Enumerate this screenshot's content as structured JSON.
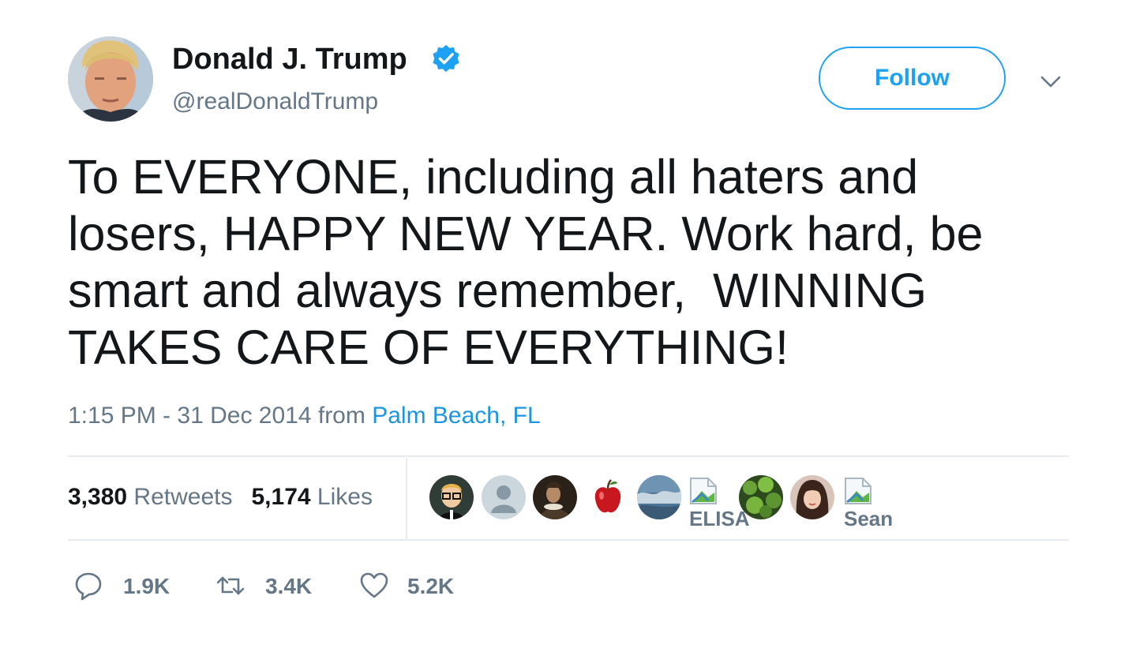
{
  "author": {
    "name": "Donald J. Trump",
    "handle": "@realDonaldTrump",
    "verified": true,
    "avatar_icon": "profile-photo"
  },
  "follow_button": {
    "label": "Follow"
  },
  "menu_icon": "chevron-down-icon",
  "tweet": {
    "text": "To EVERYONE, including all haters and\nlosers, HAPPY NEW YEAR. Work hard, be\nsmart and always remember,  WINNING\nTAKES CARE OF EVERYTHING!",
    "time": "1:15 PM - 31 Dec 2014",
    "from_word": "from",
    "location": "Palm Beach, FL"
  },
  "stats": {
    "retweets_count": "3,380",
    "retweets_label": "Retweets",
    "likes_count": "5,174",
    "likes_label": "Likes"
  },
  "likers": {
    "broken_labels": [
      "ELISA",
      "Sean"
    ]
  },
  "actions": {
    "reply_count": "1.9K",
    "retweet_count": "3.4K",
    "like_count": "5.2K"
  },
  "colors": {
    "accent": "#1da1f2",
    "link": "#1b95e0",
    "text": "#14171a",
    "secondary": "#657786",
    "divider": "#e6ecf0"
  }
}
